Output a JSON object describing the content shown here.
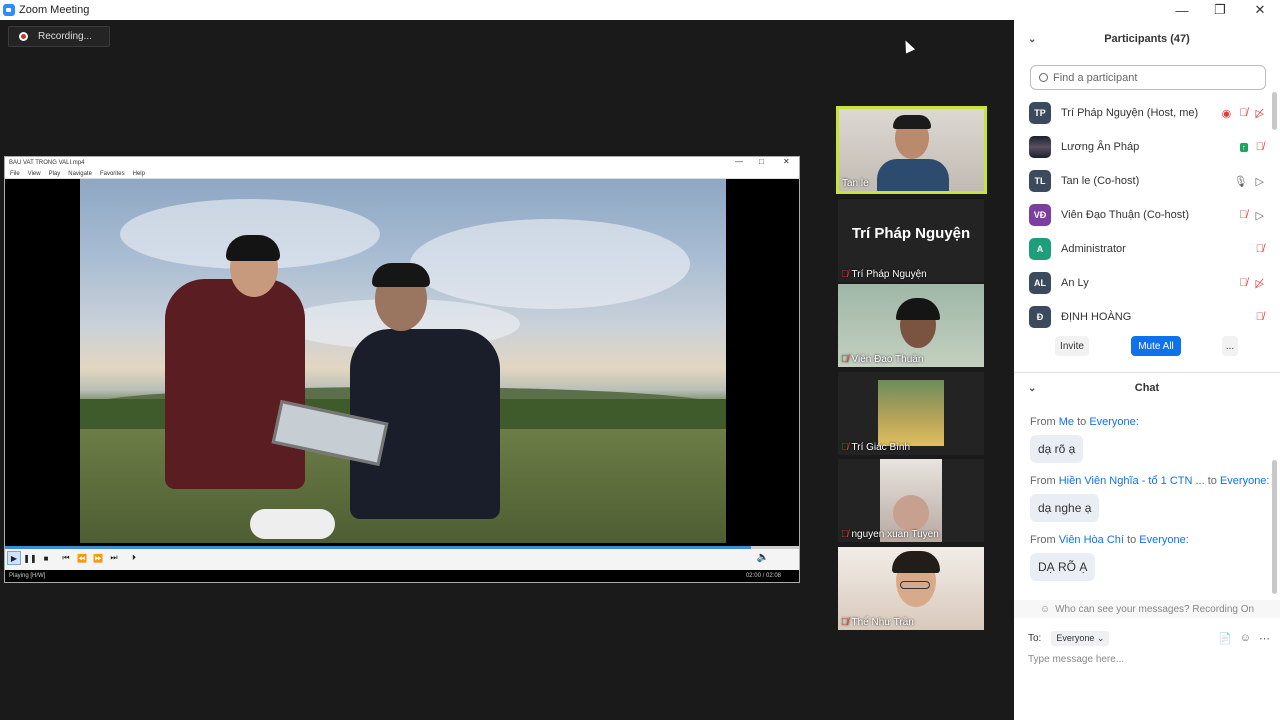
{
  "window": {
    "title": "Zoom Meeting"
  },
  "recording": {
    "label": "Recording..."
  },
  "player": {
    "title": "BAU VAT TRONG VALI.mp4",
    "menu": [
      "File",
      "View",
      "Play",
      "Navigate",
      "Favorites",
      "Help"
    ],
    "status": "Playing [H/W]",
    "time": "02:00 / 02:08",
    "progress": 0.94
  },
  "thumbnails": [
    {
      "name": "Tan le",
      "mic_muted": false,
      "active": true
    },
    {
      "name": "Trí Pháp Nguyện",
      "display_name": "Trí Pháp Nguyện",
      "mic_muted": true
    },
    {
      "name": "Viên Đạo Thuận",
      "mic_muted": true
    },
    {
      "name": "Trí Giác Bình",
      "mic_muted": true
    },
    {
      "name": "nguyen xuan Tuyen",
      "mic_muted": true
    },
    {
      "name": "Thể Như Trần",
      "mic_muted": true
    }
  ],
  "participants": {
    "title": "Participants (47)",
    "search_placeholder": "Find a participant",
    "list": [
      {
        "initials": "TP",
        "color": "#3b4a5c",
        "name": "Trí Pháp Nguyện (Host, me)"
      },
      {
        "initials": "",
        "color": "#2a2f45",
        "name": "Lương Ân Pháp"
      },
      {
        "initials": "TL",
        "color": "#3b4a5c",
        "name": "Tan le (Co-host)"
      },
      {
        "initials": "VĐ",
        "color": "#7b3fa0",
        "name": "Viên Đạo Thuận (Co-host)"
      },
      {
        "initials": "A",
        "color": "#1f9e7a",
        "name": "Administrator"
      },
      {
        "initials": "AL",
        "color": "#3b4a5c",
        "name": "An Ly"
      },
      {
        "initials": "Đ",
        "color": "#3b4a5c",
        "name": "ĐỊNH HOÀNG"
      }
    ],
    "invite_label": "Invite",
    "mute_all_label": "Mute All",
    "more_label": "..."
  },
  "chat": {
    "title": "Chat",
    "messages": [
      {
        "from_prefix": "From ",
        "sender": "Me",
        "to_prefix": " to ",
        "to": "Everyone:",
        "text": "dạ rõ ạ"
      },
      {
        "from_prefix": "From ",
        "sender": "Hiền Viên Nghĩa - tổ 1 CTN ...",
        "to_prefix": " to ",
        "to": "Everyone:",
        "text": "dạ nghe ạ"
      },
      {
        "from_prefix": "From ",
        "sender": "Viên Hòa Chí",
        "to_prefix": " to ",
        "to": "Everyone:",
        "text": "DẠ RÕ Ạ"
      }
    ],
    "privacy_note": "Who can see your messages? Recording On",
    "to_label": "To:",
    "to_value": "Everyone",
    "input_placeholder": "Type message here..."
  },
  "colors": {
    "accent": "#0e72ed",
    "active_border": "#c8e43a",
    "muted_red": "#e23b3b"
  }
}
